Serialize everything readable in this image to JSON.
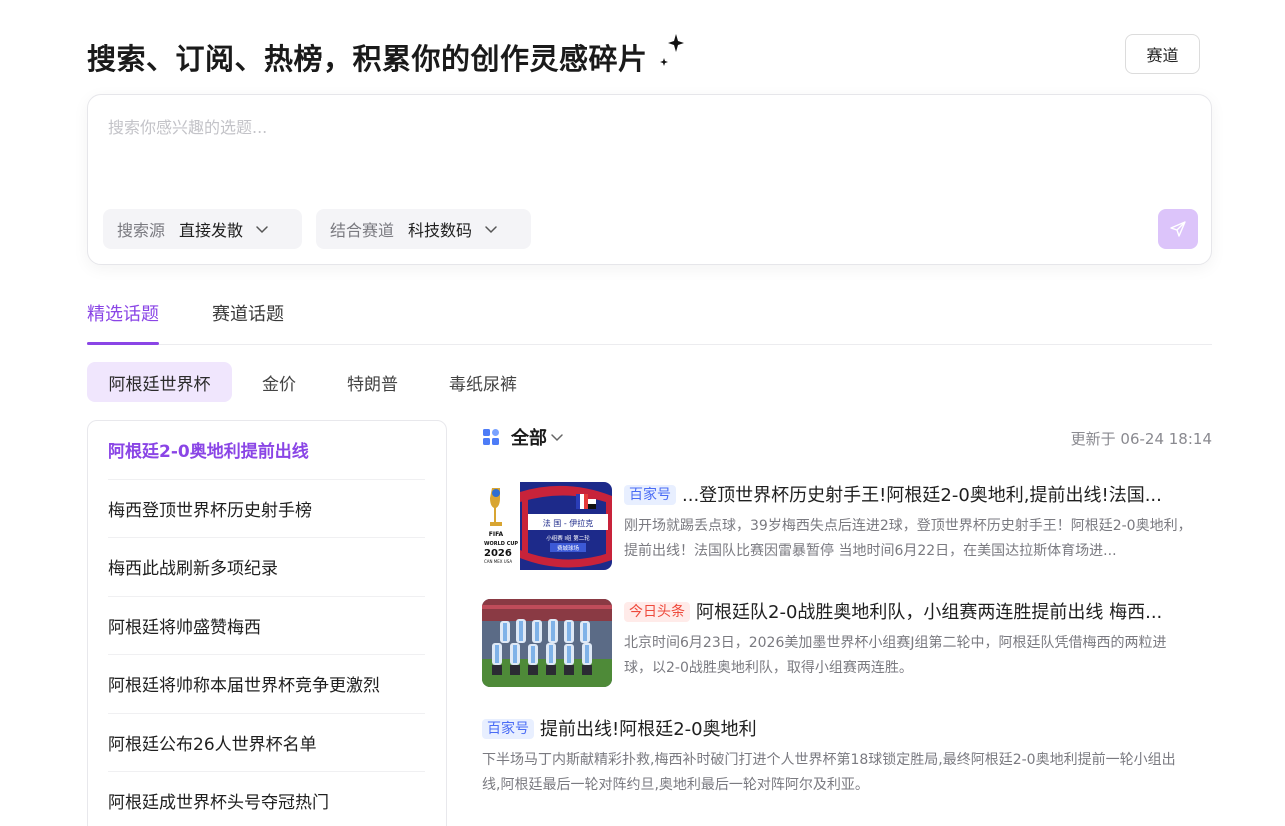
{
  "header": {
    "title": "搜索、订阅、热榜，积累你的创作灵感碎片",
    "track_button": "赛道"
  },
  "search": {
    "placeholder": "搜索你感兴趣的选题...",
    "source_label": "搜索源",
    "source_value": "直接发散",
    "track_label": "结合赛道",
    "track_value": "科技数码"
  },
  "tabs": [
    {
      "label": "精选话题",
      "active": true
    },
    {
      "label": "赛道话题",
      "active": false
    }
  ],
  "chips": [
    "阿根廷世界杯",
    "金价",
    "特朗普",
    "毒纸尿裤"
  ],
  "topics": [
    "阿根廷2-0奥地利提前出线",
    "梅西登顶世界杯历史射手榜",
    "梅西此战刷新多项纪录",
    "阿根廷将帅盛赞梅西",
    "阿根廷将帅称本届世界杯竞争更激烈",
    "阿根廷公布26人世界杯名单",
    "阿根廷成世界杯头号夺冠热门"
  ],
  "feed": {
    "filter": "全部",
    "updated": "更新于 06-24 18:14",
    "items": [
      {
        "source": "百家号",
        "title": "...登顶世界杯历史射手王!阿根廷2-0奥地利,提前出线!法国...",
        "summary": "刚开场就踢丢点球，39岁梅西失点后连进2球，登顶世界杯历史射手王！阿根廷2-0奥地利，提前出线！法国队比赛因雷暴暂停 当地时间6月22日，在美国达拉斯体育场进...",
        "thumb_text": {
          "brand": "FIFA",
          "cup": "WORLD CUP",
          "year": "2026",
          "hosts": "CAN MEX USA",
          "match": "法 国 - 伊拉克",
          "round": "小组赛 I组 第二轮",
          "venue": "费城球场"
        }
      },
      {
        "source": "今日头条",
        "title": "阿根廷队2-0战胜奥地利队，小组赛两连胜提前出线 梅西...",
        "summary": "北京时间6月23日，2026美加墨世界杯小组赛J组第二轮中，阿根廷队凭借梅西的两粒进球，以2-0战胜奥地利队，取得小组赛两连胜。"
      },
      {
        "source": "百家号",
        "title": "提前出线!阿根廷2-0奥地利",
        "summary": "下半场马丁内斯献精彩扑救,梅西补时破门打进个人世界杯第18球锁定胜局,最终阿根廷2-0奥地利提前一轮小组出线,阿根廷最后一轮对阵约旦,奥地利最后一轮对阵阿尔及利亚。"
      }
    ]
  },
  "colors": {
    "accent": "#8a45e6",
    "accent_soft": "#f0e6fd",
    "send_disabled": "#dcc4fa"
  }
}
